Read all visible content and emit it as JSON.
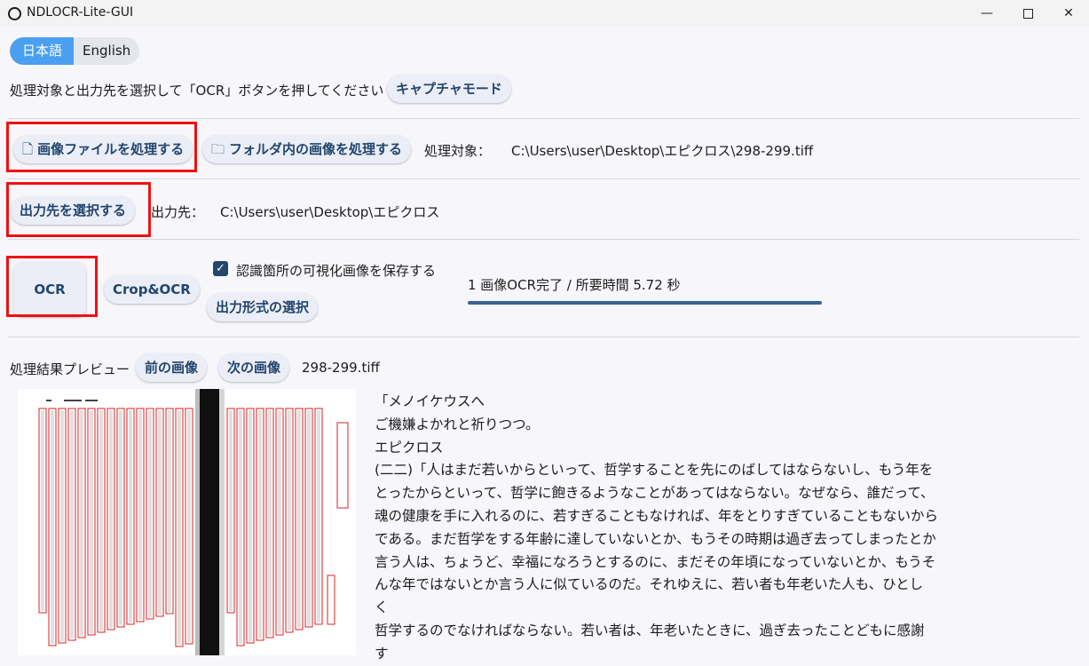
{
  "window": {
    "title": "NDLOCR-Lite-GUI",
    "minimize_glyph": "—",
    "close_glyph": "✕"
  },
  "language": {
    "options": [
      "日本語",
      "English"
    ],
    "selected": "日本語"
  },
  "instruction": "処理対象と出力先を選択して「OCR」ボタンを押してください",
  "capture_button": "キャプチャモード",
  "source": {
    "file_button": "画像ファイルを処理する",
    "folder_button": "フォルダ内の画像を処理する",
    "label": "処理対象：",
    "path": "C:\\Users\\user\\Desktop\\エピクロス\\298-299.tiff"
  },
  "output": {
    "button": "出力先を選択する",
    "label": "出力先：",
    "path": "C:\\Users\\user\\Desktop\\エピクロス"
  },
  "run": {
    "ocr_button": "OCR",
    "crop_button": "Crop&OCR",
    "save_visualization_label": "認識箇所の可視化画像を保存する",
    "save_visualization_checked": true,
    "format_button": "出力形式の選択",
    "status": "1 画像OCR完了 / 所要時間 5.72 秒",
    "progress_percent": 100
  },
  "preview": {
    "label": "処理結果プレビュー",
    "prev_button": "前の画像",
    "next_button": "次の画像",
    "filename": "298-299.tiff",
    "text_lines": [
      "「メノイケウスへ",
      "ご機嫌よかれと祈りつつ。",
      "エピクロス",
      "(二二)「人はまだ若いからといって、哲学することを先にのばしてはならないし、もう年を",
      "とったからといって、哲学に飽きるようなことがあってはならない。なぜなら、誰だって、",
      "魂の健康を手に入れるのに、若すぎることもなければ、年をとりすぎていることもないから",
      "である。まだ哲学をする年齢に達していないとか、もうその時期は過ぎ去ってしまったとか",
      "言う人は、ちょうど、幸福になろうとするのに、まだその年頃になっていないとか、もうそ",
      "んな年ではないとか言う人に似ているのだ。それゆえに、若い者も年老いた人も、ひとし",
      "く",
      "哲学するのでなければならない。若い者は、年老いたときに、過ぎ去ったことどもに感謝",
      "す"
    ]
  },
  "colors": {
    "accent_blue": "#4a9ff0",
    "button_text": "#22456e",
    "highlight_red": "#ee1111"
  }
}
